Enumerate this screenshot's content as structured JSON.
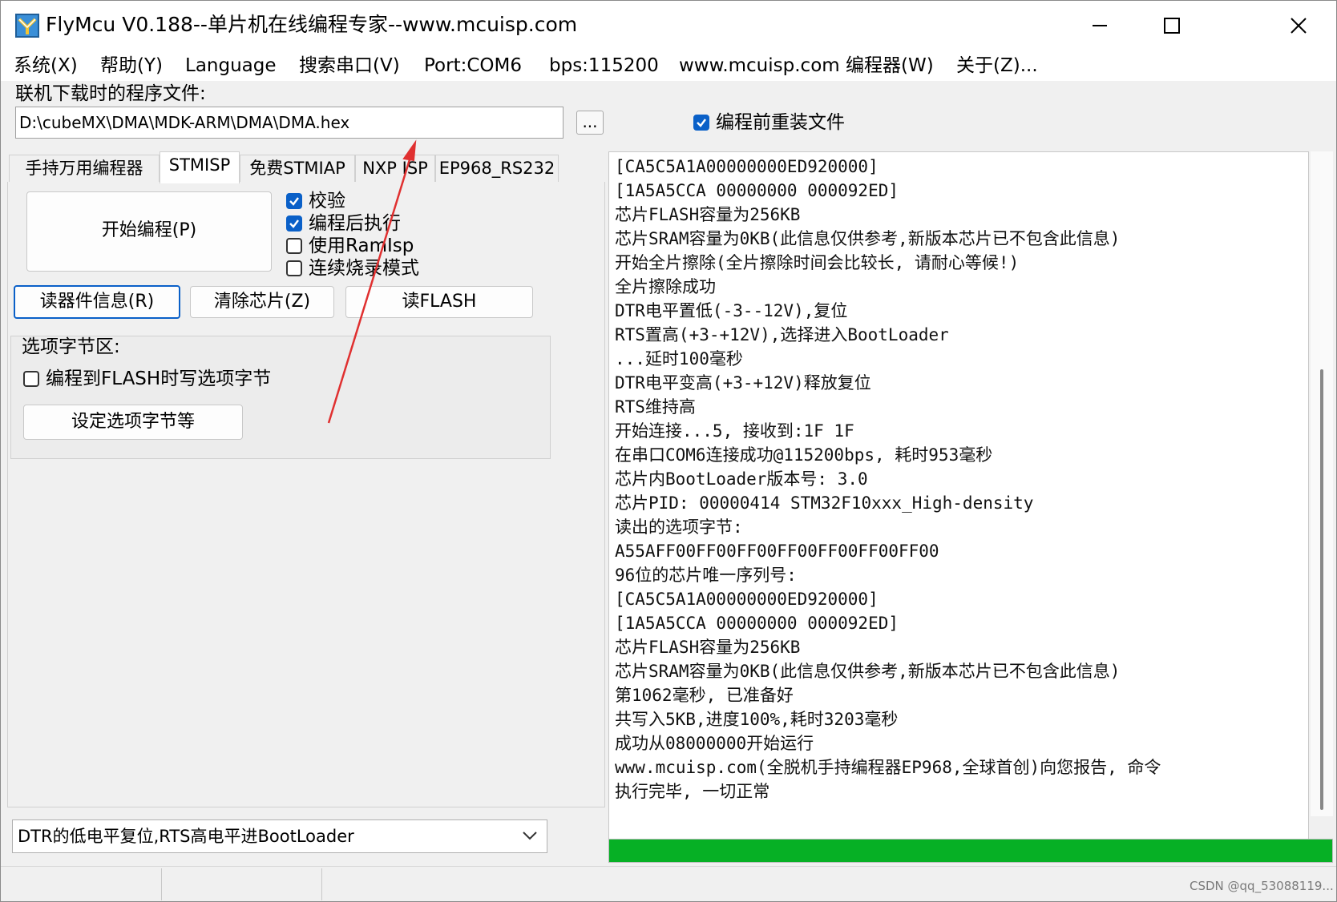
{
  "window": {
    "title": "FlyMcu V0.188--单片机在线编程专家--www.mcuisp.com"
  },
  "menu": {
    "items": [
      {
        "label": "系统(X)"
      },
      {
        "label": "帮助(Y)"
      },
      {
        "label": "Language"
      },
      {
        "label": "搜索串口(V)"
      },
      {
        "label": "Port:COM6"
      },
      {
        "label": "bps:115200"
      },
      {
        "label": "www.mcuisp.com 编程器(W)"
      },
      {
        "label": "关于(Z)..."
      }
    ]
  },
  "file": {
    "label": "联机下载时的程序文件:",
    "path": "D:\\cubeMX\\DMA\\MDK-ARM\\DMA\\DMA.hex",
    "browse_label": "...",
    "reload_checkbox": {
      "label": "编程前重装文件",
      "checked": true
    }
  },
  "tabs": [
    {
      "label": "手持万用编程器",
      "active": false
    },
    {
      "label": "STMISP",
      "active": true
    },
    {
      "label": "免费STMIAP",
      "active": false
    },
    {
      "label": "NXP ISP",
      "active": false
    },
    {
      "label": "EP968_RS232",
      "active": false
    }
  ],
  "stmisp": {
    "start_button": "开始编程(P)",
    "options": [
      {
        "label": "校验",
        "checked": true
      },
      {
        "label": "编程后执行",
        "checked": true
      },
      {
        "label": "使用RamIsp",
        "checked": false
      },
      {
        "label": "连续烧录模式",
        "checked": false
      }
    ],
    "read_info_button": "读器件信息(R)",
    "erase_button": "清除芯片(Z)",
    "read_flash_button": "读FLASH",
    "option_bytes": {
      "title": "选项字节区:",
      "checkbox": {
        "label": "编程到FLASH时写选项字节",
        "checked": false
      },
      "button": "设定选项字节等"
    },
    "reset_mode": "DTR的低电平复位,RTS高电平进BootLoader"
  },
  "log": {
    "lines": [
      "[CA5C5A1A00000000ED920000]",
      "[1A5A5CCA 00000000 000092ED]",
      "芯片FLASH容量为256KB",
      "芯片SRAM容量为0KB(此信息仅供参考,新版本芯片已不包含此信息)",
      "开始全片擦除(全片擦除时间会比较长, 请耐心等候!)",
      "全片擦除成功",
      "DTR电平置低(-3--12V),复位",
      "RTS置高(+3-+12V),选择进入BootLoader",
      "...延时100毫秒",
      "DTR电平变高(+3-+12V)释放复位",
      "RTS维持高",
      "开始连接...5, 接收到:1F 1F",
      "在串口COM6连接成功@115200bps, 耗时953毫秒",
      "芯片内BootLoader版本号: 3.0",
      "芯片PID: 00000414  STM32F10xxx_High-density",
      "读出的选项字节:",
      "A55AFF00FF00FF00FF00FF00FF00FF00",
      "96位的芯片唯一序列号:",
      "[CA5C5A1A00000000ED920000]",
      "[1A5A5CCA 00000000 000092ED]",
      "芯片FLASH容量为256KB",
      "芯片SRAM容量为0KB(此信息仅供参考,新版本芯片已不包含此信息)",
      "第1062毫秒, 已准备好",
      "共写入5KB,进度100%,耗时3203毫秒",
      "成功从08000000开始运行",
      "www.mcuisp.com(全脱机手持编程器EP968,全球首创)向您报告, 命令",
      "执行完毕, 一切正常"
    ]
  },
  "progress": {
    "value": 1.0,
    "color": "#06b025"
  },
  "watermark": "CSDN @qq_53088119..."
}
